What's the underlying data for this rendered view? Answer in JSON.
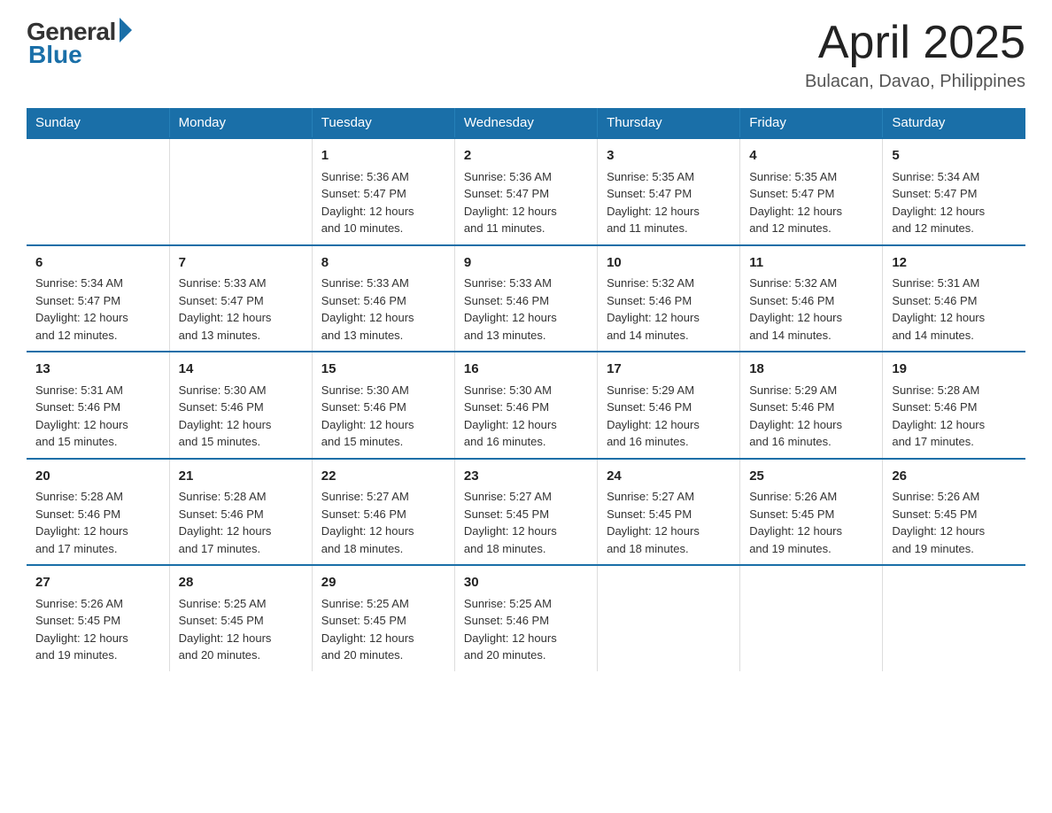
{
  "header": {
    "logo_general": "General",
    "logo_blue": "Blue",
    "title": "April 2025",
    "location": "Bulacan, Davao, Philippines"
  },
  "weekdays": [
    "Sunday",
    "Monday",
    "Tuesday",
    "Wednesday",
    "Thursday",
    "Friday",
    "Saturday"
  ],
  "weeks": [
    [
      {
        "day": "",
        "info": ""
      },
      {
        "day": "",
        "info": ""
      },
      {
        "day": "1",
        "info": "Sunrise: 5:36 AM\nSunset: 5:47 PM\nDaylight: 12 hours\nand 10 minutes."
      },
      {
        "day": "2",
        "info": "Sunrise: 5:36 AM\nSunset: 5:47 PM\nDaylight: 12 hours\nand 11 minutes."
      },
      {
        "day": "3",
        "info": "Sunrise: 5:35 AM\nSunset: 5:47 PM\nDaylight: 12 hours\nand 11 minutes."
      },
      {
        "day": "4",
        "info": "Sunrise: 5:35 AM\nSunset: 5:47 PM\nDaylight: 12 hours\nand 12 minutes."
      },
      {
        "day": "5",
        "info": "Sunrise: 5:34 AM\nSunset: 5:47 PM\nDaylight: 12 hours\nand 12 minutes."
      }
    ],
    [
      {
        "day": "6",
        "info": "Sunrise: 5:34 AM\nSunset: 5:47 PM\nDaylight: 12 hours\nand 12 minutes."
      },
      {
        "day": "7",
        "info": "Sunrise: 5:33 AM\nSunset: 5:47 PM\nDaylight: 12 hours\nand 13 minutes."
      },
      {
        "day": "8",
        "info": "Sunrise: 5:33 AM\nSunset: 5:46 PM\nDaylight: 12 hours\nand 13 minutes."
      },
      {
        "day": "9",
        "info": "Sunrise: 5:33 AM\nSunset: 5:46 PM\nDaylight: 12 hours\nand 13 minutes."
      },
      {
        "day": "10",
        "info": "Sunrise: 5:32 AM\nSunset: 5:46 PM\nDaylight: 12 hours\nand 14 minutes."
      },
      {
        "day": "11",
        "info": "Sunrise: 5:32 AM\nSunset: 5:46 PM\nDaylight: 12 hours\nand 14 minutes."
      },
      {
        "day": "12",
        "info": "Sunrise: 5:31 AM\nSunset: 5:46 PM\nDaylight: 12 hours\nand 14 minutes."
      }
    ],
    [
      {
        "day": "13",
        "info": "Sunrise: 5:31 AM\nSunset: 5:46 PM\nDaylight: 12 hours\nand 15 minutes."
      },
      {
        "day": "14",
        "info": "Sunrise: 5:30 AM\nSunset: 5:46 PM\nDaylight: 12 hours\nand 15 minutes."
      },
      {
        "day": "15",
        "info": "Sunrise: 5:30 AM\nSunset: 5:46 PM\nDaylight: 12 hours\nand 15 minutes."
      },
      {
        "day": "16",
        "info": "Sunrise: 5:30 AM\nSunset: 5:46 PM\nDaylight: 12 hours\nand 16 minutes."
      },
      {
        "day": "17",
        "info": "Sunrise: 5:29 AM\nSunset: 5:46 PM\nDaylight: 12 hours\nand 16 minutes."
      },
      {
        "day": "18",
        "info": "Sunrise: 5:29 AM\nSunset: 5:46 PM\nDaylight: 12 hours\nand 16 minutes."
      },
      {
        "day": "19",
        "info": "Sunrise: 5:28 AM\nSunset: 5:46 PM\nDaylight: 12 hours\nand 17 minutes."
      }
    ],
    [
      {
        "day": "20",
        "info": "Sunrise: 5:28 AM\nSunset: 5:46 PM\nDaylight: 12 hours\nand 17 minutes."
      },
      {
        "day": "21",
        "info": "Sunrise: 5:28 AM\nSunset: 5:46 PM\nDaylight: 12 hours\nand 17 minutes."
      },
      {
        "day": "22",
        "info": "Sunrise: 5:27 AM\nSunset: 5:46 PM\nDaylight: 12 hours\nand 18 minutes."
      },
      {
        "day": "23",
        "info": "Sunrise: 5:27 AM\nSunset: 5:45 PM\nDaylight: 12 hours\nand 18 minutes."
      },
      {
        "day": "24",
        "info": "Sunrise: 5:27 AM\nSunset: 5:45 PM\nDaylight: 12 hours\nand 18 minutes."
      },
      {
        "day": "25",
        "info": "Sunrise: 5:26 AM\nSunset: 5:45 PM\nDaylight: 12 hours\nand 19 minutes."
      },
      {
        "day": "26",
        "info": "Sunrise: 5:26 AM\nSunset: 5:45 PM\nDaylight: 12 hours\nand 19 minutes."
      }
    ],
    [
      {
        "day": "27",
        "info": "Sunrise: 5:26 AM\nSunset: 5:45 PM\nDaylight: 12 hours\nand 19 minutes."
      },
      {
        "day": "28",
        "info": "Sunrise: 5:25 AM\nSunset: 5:45 PM\nDaylight: 12 hours\nand 20 minutes."
      },
      {
        "day": "29",
        "info": "Sunrise: 5:25 AM\nSunset: 5:45 PM\nDaylight: 12 hours\nand 20 minutes."
      },
      {
        "day": "30",
        "info": "Sunrise: 5:25 AM\nSunset: 5:46 PM\nDaylight: 12 hours\nand 20 minutes."
      },
      {
        "day": "",
        "info": ""
      },
      {
        "day": "",
        "info": ""
      },
      {
        "day": "",
        "info": ""
      }
    ]
  ]
}
